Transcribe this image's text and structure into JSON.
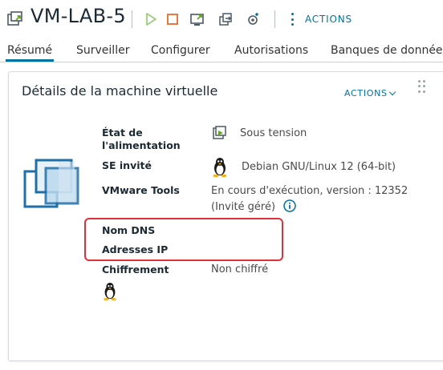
{
  "header": {
    "vm_name": "VM-LAB-5",
    "icons": [
      "vm-small-icon",
      "power-on-icon",
      "power-off-icon",
      "console-icon",
      "migrate-icon",
      "settings-icon"
    ],
    "actions_label": "ACTIONS"
  },
  "tabs": [
    {
      "label": "Résumé",
      "active": true
    },
    {
      "label": "Surveiller",
      "active": false
    },
    {
      "label": "Configurer",
      "active": false
    },
    {
      "label": "Autorisations",
      "active": false
    },
    {
      "label": "Banques de données",
      "active": false
    }
  ],
  "card": {
    "title": "Détails de la machine virtuelle",
    "actions_label": "ACTIONS",
    "rows": {
      "power_label_1": "État de",
      "power_label_2": "l'alimentation",
      "power_value": "Sous tension",
      "guest_os_label": "SE invité",
      "guest_os_value": "Debian GNU/Linux 12 (64-bit)",
      "tools_label": "VMware Tools",
      "tools_value_1": "En cours d'exécution, version : 12352",
      "tools_value_2": "(Invité géré)",
      "dns_label": "Nom DNS",
      "ip_label": "Adresses IP",
      "encryption_label": "Chiffrement",
      "encryption_value": "Non chiffré"
    }
  },
  "colors": {
    "accent": "#0072a3",
    "power_on_green": "#62a420",
    "power_off_orange": "#e06c2a",
    "highlight_red": "#e0303a"
  }
}
